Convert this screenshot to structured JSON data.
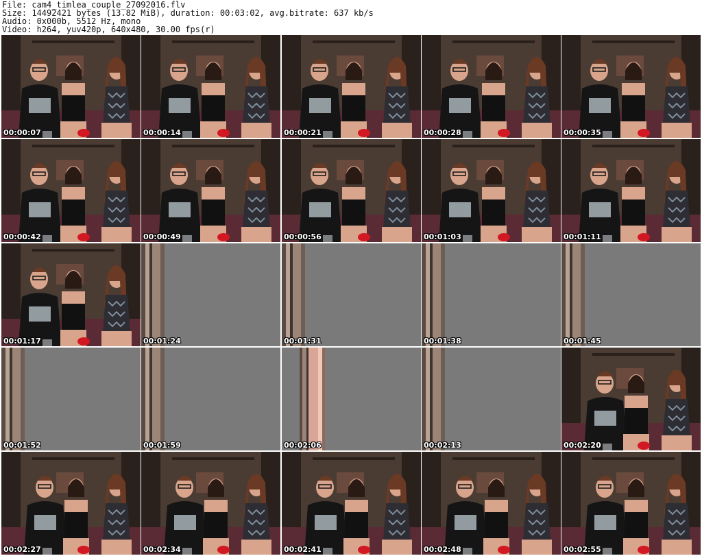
{
  "header": {
    "file_line": "File: cam4_timlea_couple_27092016.flv",
    "size_line": "Size: 14492421 bytes (13.82 MiB), duration: 00:03:02, avg.bitrate: 637 kb/s",
    "audio_line": "Audio: 0x000b, 5512 Hz, mono",
    "video_line": "Video: h264, yuv420p, 640x480, 30.00 fps(r)"
  },
  "thumbnails": [
    {
      "time": "00:00:07",
      "kind": "scene"
    },
    {
      "time": "00:00:14",
      "kind": "scene"
    },
    {
      "time": "00:00:21",
      "kind": "scene"
    },
    {
      "time": "00:00:28",
      "kind": "scene"
    },
    {
      "time": "00:00:35",
      "kind": "scene"
    },
    {
      "time": "00:00:42",
      "kind": "scene"
    },
    {
      "time": "00:00:49",
      "kind": "scene"
    },
    {
      "time": "00:00:56",
      "kind": "scene"
    },
    {
      "time": "00:01:03",
      "kind": "scene"
    },
    {
      "time": "00:01:11",
      "kind": "scene"
    },
    {
      "time": "00:01:17",
      "kind": "scene"
    },
    {
      "time": "00:01:24",
      "kind": "blank"
    },
    {
      "time": "00:01:31",
      "kind": "blank"
    },
    {
      "time": "00:01:38",
      "kind": "blank"
    },
    {
      "time": "00:01:45",
      "kind": "blank"
    },
    {
      "time": "00:01:52",
      "kind": "blank"
    },
    {
      "time": "00:01:59",
      "kind": "blank"
    },
    {
      "time": "00:02:06",
      "kind": "blank-pink"
    },
    {
      "time": "00:02:13",
      "kind": "blank"
    },
    {
      "time": "00:02:20",
      "kind": "scene-wide"
    },
    {
      "time": "00:02:27",
      "kind": "scene-wide"
    },
    {
      "time": "00:02:34",
      "kind": "scene-wide"
    },
    {
      "time": "00:02:41",
      "kind": "scene-wide"
    },
    {
      "time": "00:02:48",
      "kind": "scene-wide"
    },
    {
      "time": "00:02:55",
      "kind": "scene-wide"
    }
  ],
  "colors": {
    "wall": "#4a3b33",
    "shelf": "#2a211c",
    "sofa": "#5a2a35",
    "shirt": "#151515",
    "skin": "#d8a48c",
    "hair_brown": "#6b3a24",
    "hair_dark": "#2a1a14",
    "dress": "#2d2d33",
    "dress_pattern": "#7f8d9a",
    "red_cup": "#d21822",
    "gray_panel": "#7a7a7a",
    "edge_tan": "#9c8576",
    "pink_edge": "#d9a596"
  }
}
